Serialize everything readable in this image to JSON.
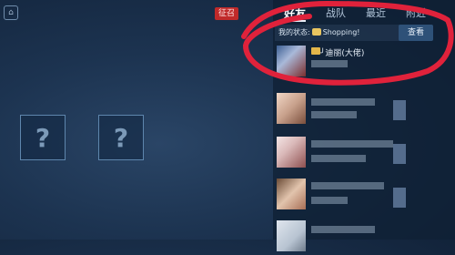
{
  "top_bar": {
    "recruit_badge": "征召"
  },
  "left_area": {
    "cards": [
      {
        "symbol": "?"
      },
      {
        "symbol": "?"
      }
    ]
  },
  "friends_panel": {
    "tabs": [
      {
        "label": "好友",
        "active": true
      },
      {
        "label": "战队",
        "active": false
      },
      {
        "label": "最近",
        "active": false
      },
      {
        "label": "附近",
        "active": false
      }
    ],
    "status_label": "我的状态:",
    "status_value": "Shopping!",
    "view_button": "查看",
    "friends": [
      {
        "name": "╯迪丽(大佬)",
        "icon": "crown-icon"
      }
    ]
  },
  "colors": {
    "panel_bg": "#0e1e32",
    "accent_red": "#c02a2a",
    "annotation": "#e0223b"
  },
  "icons": [
    "home-icon",
    "settings-icon",
    "question-card-icon",
    "status-emoji-icon",
    "crown-icon"
  ]
}
